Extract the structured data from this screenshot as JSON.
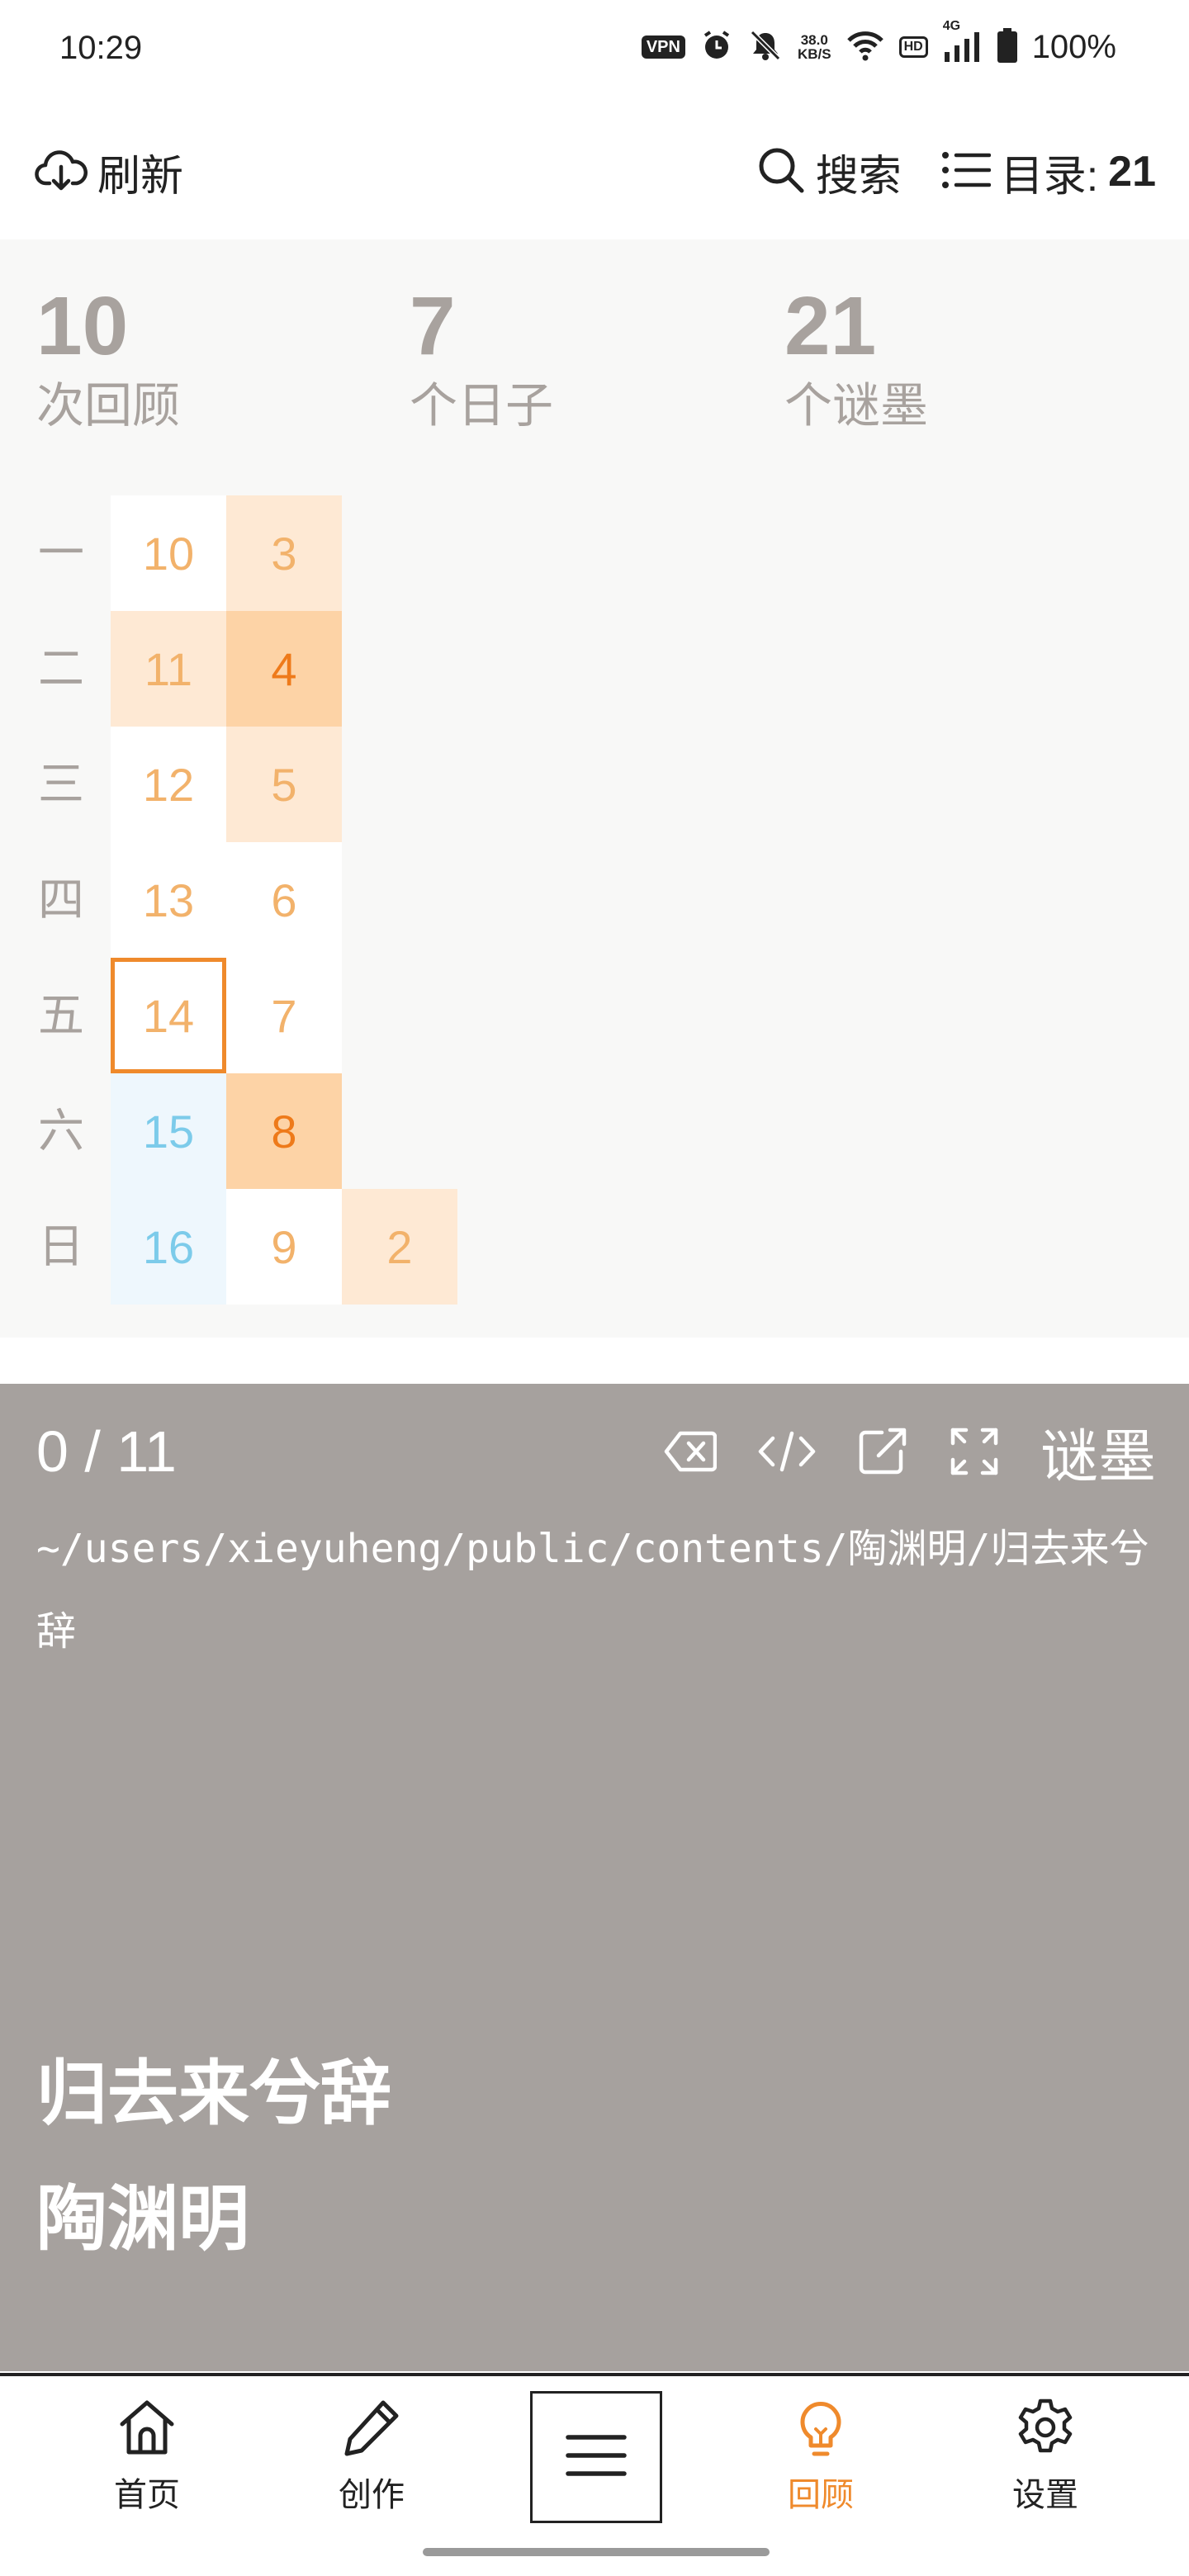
{
  "status_bar": {
    "time": "10:29",
    "vpn": "VPN",
    "speed_value": "38.0",
    "speed_unit": "KB/S",
    "hd": "HD",
    "network": "4G",
    "battery": "100%"
  },
  "toolbar": {
    "refresh_label": "刷新",
    "search_label": "搜索",
    "toc_label": "目录:",
    "toc_count": "21"
  },
  "stats": [
    {
      "value": "10",
      "label": "次回顾"
    },
    {
      "value": "7",
      "label": "个日子"
    },
    {
      "value": "21",
      "label": "个谜墨"
    }
  ],
  "calendar": {
    "weekdays": [
      "一",
      "二",
      "三",
      "四",
      "五",
      "六",
      "日"
    ],
    "columns": [
      [
        {
          "day": "10",
          "level": 0
        },
        {
          "day": "11",
          "level": 1
        },
        {
          "day": "12",
          "level": 0
        },
        {
          "day": "13",
          "level": 0
        },
        {
          "day": "14",
          "level": 0,
          "today": true
        },
        {
          "day": "15",
          "level": 0,
          "future": true
        },
        {
          "day": "16",
          "level": 0,
          "future": true
        }
      ],
      [
        {
          "day": "3",
          "level": 1
        },
        {
          "day": "4",
          "level": 2
        },
        {
          "day": "5",
          "level": 1
        },
        {
          "day": "6",
          "level": 0
        },
        {
          "day": "7",
          "level": 0
        },
        {
          "day": "8",
          "level": 2
        },
        {
          "day": "9",
          "level": 0
        }
      ],
      [
        {
          "day": "",
          "level": -1
        },
        {
          "day": "",
          "level": -1
        },
        {
          "day": "",
          "level": -1
        },
        {
          "day": "",
          "level": -1
        },
        {
          "day": "",
          "level": -1
        },
        {
          "day": "",
          "level": -1
        },
        {
          "day": "2",
          "level": 1
        }
      ]
    ],
    "colors": {
      "level0_bg": "#ffffff",
      "level1_bg": "#fee9d4",
      "level2_bg": "#fdd3a6",
      "future_bg": "#eef7fd",
      "future_text": "#7ccbea",
      "text_light": "#f2b26b",
      "text_dark": "#ee7a1a",
      "today_border": "#ef8a2c"
    }
  },
  "card": {
    "counter": "0 / 11",
    "icons": [
      "backspace-icon",
      "code-icon",
      "open-external-icon",
      "fullscreen-icon"
    ],
    "brand": "谜墨",
    "path": "~/users/xieyuheng/public/contents/陶渊明/归去来兮辞",
    "title": "归去来兮辞",
    "author": "陶渊明",
    "bg_color": "#a6a19e"
  },
  "bottom_nav": {
    "items": [
      {
        "label": "首页",
        "icon": "home-icon",
        "active": false
      },
      {
        "label": "创作",
        "icon": "pencil-icon",
        "active": false
      },
      {
        "label": "",
        "icon": "menu-icon",
        "active": false
      },
      {
        "label": "回顾",
        "icon": "lightbulb-icon",
        "active": true
      },
      {
        "label": "设置",
        "icon": "gear-icon",
        "active": false
      }
    ],
    "active_color": "#ef8a2c"
  }
}
